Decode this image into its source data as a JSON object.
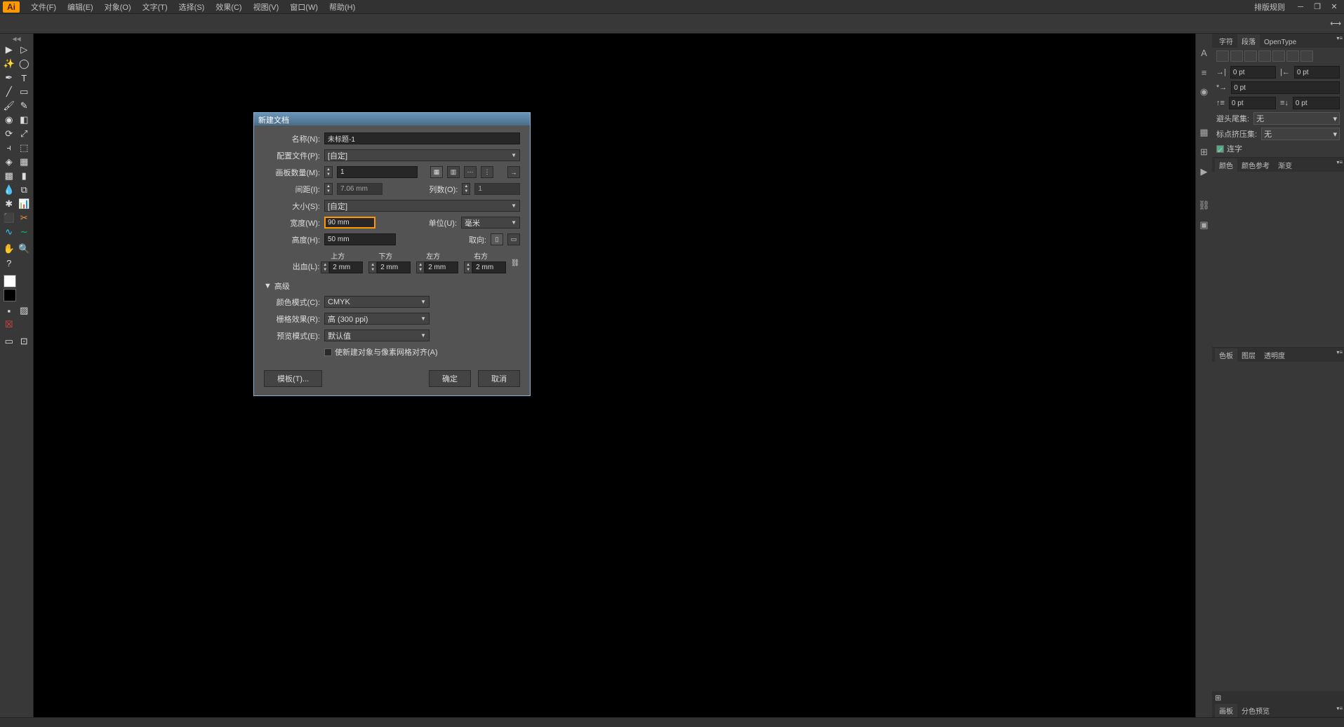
{
  "app": {
    "logo": "Ai"
  },
  "menu": {
    "file": "文件(F)",
    "edit": "编辑(E)",
    "object": "对象(O)",
    "type": "文字(T)",
    "select": "选择(S)",
    "effect": "效果(C)",
    "view": "视图(V)",
    "window": "窗口(W)",
    "help": "帮助(H)"
  },
  "menubar_right": {
    "layout_rules": "排版规则"
  },
  "dialog": {
    "title": "新建文档",
    "name_label": "名称(N):",
    "name_value": "未标题-1",
    "profile_label": "配置文件(P):",
    "profile_value": "[自定]",
    "artboards_label": "画板数量(M):",
    "artboards_value": "1",
    "spacing_label": "间距(I):",
    "spacing_value": "7.06 mm",
    "columns_label": "列数(O):",
    "columns_value": "1",
    "size_label": "大小(S):",
    "size_value": "[自定]",
    "width_label": "宽度(W):",
    "width_value": "90 mm",
    "units_label": "单位(U):",
    "units_value": "毫米",
    "height_label": "高度(H):",
    "height_value": "50 mm",
    "orient_label": "取向:",
    "bleed_label": "出血(L):",
    "bleed_top": "上方",
    "bleed_bottom": "下方",
    "bleed_left": "左方",
    "bleed_right": "右方",
    "bleed_value": "2 mm",
    "advanced": "高级",
    "color_mode_label": "颜色模式(C):",
    "color_mode_value": "CMYK",
    "raster_label": "栅格效果(R):",
    "raster_value": "高 (300 ppi)",
    "preview_label": "预览模式(E):",
    "preview_value": "默认值",
    "pixel_align": "使新建对象与像素网格对齐(A)",
    "template_btn": "模板(T)...",
    "ok_btn": "确定",
    "cancel_btn": "取消"
  },
  "panels": {
    "char_tab": "字符",
    "para_tab": "段落",
    "opentype_tab": "OpenType",
    "pt0": "0 pt",
    "trailer_label": "避头尾集:",
    "trailer_value": "无",
    "punct_label": "标点挤压集:",
    "punct_value": "无",
    "hyphenate": "连字",
    "color_tab": "颜色",
    "color_guide_tab": "颜色参考",
    "gradient_tab": "渐变",
    "swatches_tab": "色板",
    "layers_tab": "图层",
    "transparency_tab": "透明度",
    "footer_swatches": "画板",
    "footer_sep": "分色预览"
  }
}
